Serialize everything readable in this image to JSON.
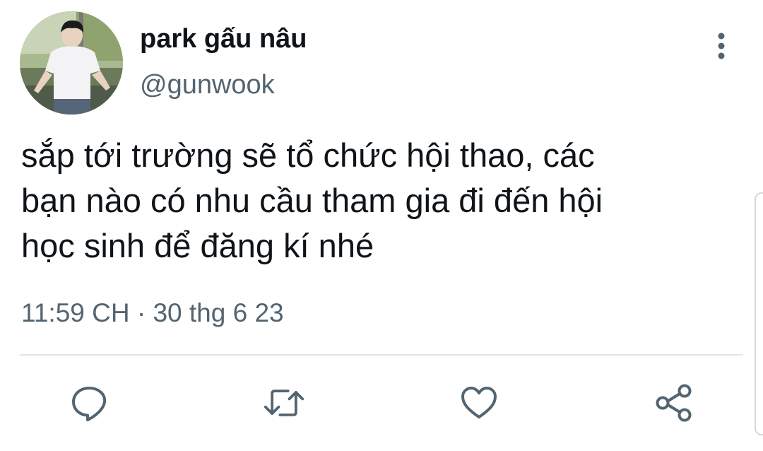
{
  "tweet": {
    "author": {
      "display_name": "park gấu nâu",
      "handle": "@gunwook"
    },
    "text_lines": [
      "sắp tới trường sẽ tổ chức hội thao, các",
      "bạn nào có nhu cầu tham gia đi đến hội",
      "học sinh để đăng kí nhé"
    ],
    "timestamp": "11:59 CH · 30 thg 6 23"
  },
  "actions": {
    "reply_icon": "speech-bubble",
    "retweet_icon": "retweet-arrows",
    "like_icon": "heart",
    "share_icon": "share-nodes",
    "more_icon": "vertical-ellipsis"
  },
  "colors": {
    "text": "#0f1419",
    "secondary": "#536471",
    "divider": "#e1e6ea"
  }
}
